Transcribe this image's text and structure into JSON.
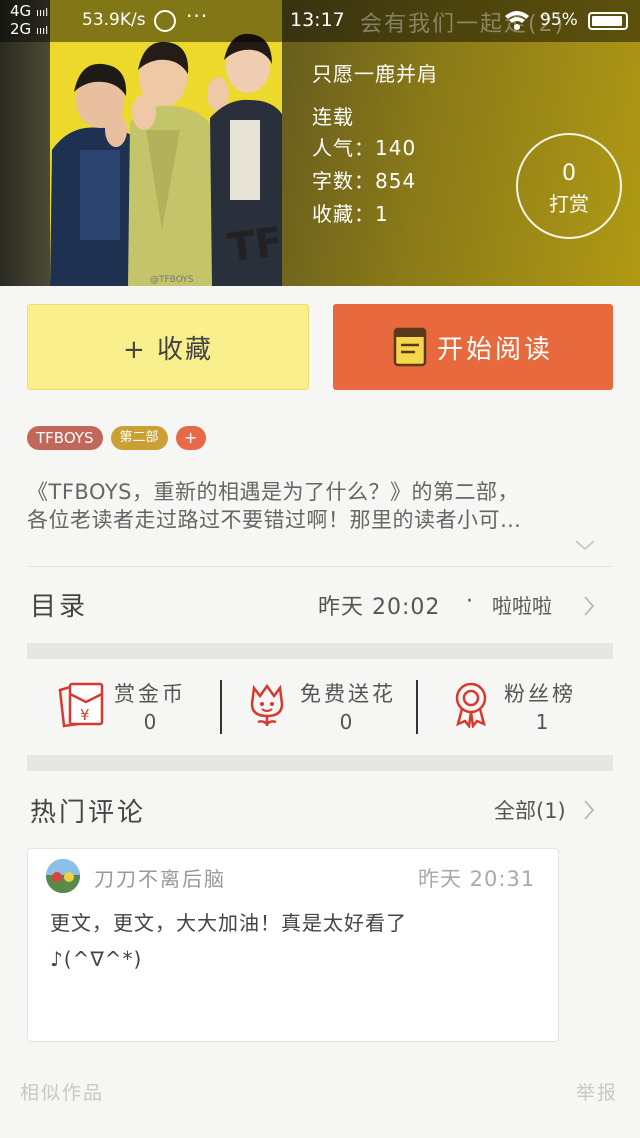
{
  "status_bar": {
    "net1": "4G",
    "net2": "2G",
    "speed": "53.9K/s",
    "dots": "···",
    "time": "13:17",
    "title_ghost": "会有我们一起走(2)",
    "battery": "95%",
    "battery_level": 0.95
  },
  "book": {
    "author": "只愿一鹿并肩",
    "status": "连载",
    "popularity_label": "人气：",
    "popularity": "140",
    "words_label": "字数：",
    "words": "854",
    "favorites_label": "收藏：",
    "favorites": "1",
    "reward_count": "0",
    "reward_label": "打赏"
  },
  "actions": {
    "favorite": "+ 收藏",
    "read": "开始阅读"
  },
  "tags": {
    "t1": "TFBOYS",
    "t2": "第二部",
    "add": "+"
  },
  "description": {
    "line1": "《TFBOYS，重新的相遇是为了什么？》的第二部，",
    "line2": "各位老读者走过路过不要错过啊！那里的读者小可…"
  },
  "catalog": {
    "label": "目录",
    "update_time": "昨天 20:02",
    "dot": "·",
    "latest_chapter": "啦啦啦"
  },
  "stats": {
    "coins_label": "赏金币",
    "coins": "0",
    "flowers_label": "免费送花",
    "flowers": "0",
    "fans_label": "粉丝榜",
    "fans": "1"
  },
  "hot_comments": {
    "label": "热门评论",
    "all": "全部(1)"
  },
  "comment": {
    "user": "刀刀不离后脑",
    "time": "昨天 20:31",
    "text1": "更文，更文，大大加油！真是太好看了",
    "text2": "♪(^∇^*)"
  },
  "footer": {
    "similar": "相似作品",
    "report": "举报"
  },
  "colors": {
    "accent_orange": "#e8693e",
    "fav_yellow": "#f9ef8c",
    "icon_red": "#d8392e"
  }
}
